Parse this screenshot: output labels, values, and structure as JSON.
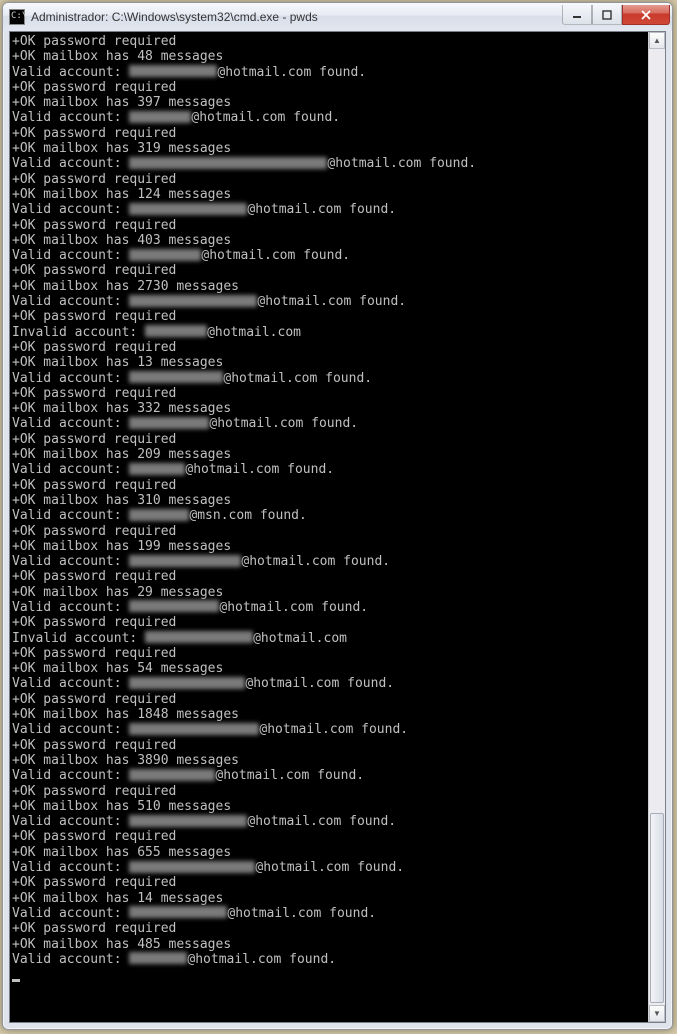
{
  "window": {
    "title": "Administrador: C:\\Windows\\system32\\cmd.exe - pwds",
    "icon_glyph": "C:\\"
  },
  "console_lines": [
    {
      "t": "plain",
      "text": "+OK password required"
    },
    {
      "t": "plain",
      "text": "+OK mailbox has 48 messages"
    },
    {
      "t": "valid",
      "redacted_w": 88,
      "domain": "@hotmail.com"
    },
    {
      "t": "plain",
      "text": "+OK password required"
    },
    {
      "t": "plain",
      "text": "+OK mailbox has 397 messages"
    },
    {
      "t": "valid",
      "redacted_w": 62,
      "domain": "@hotmail.com"
    },
    {
      "t": "plain",
      "text": "+OK password required"
    },
    {
      "t": "plain",
      "text": "+OK mailbox has 319 messages"
    },
    {
      "t": "valid",
      "redacted_w": 198,
      "domain": "@hotmail.com"
    },
    {
      "t": "plain",
      "text": "+OK password required"
    },
    {
      "t": "plain",
      "text": "+OK mailbox has 124 messages"
    },
    {
      "t": "valid",
      "redacted_w": 118,
      "domain": "@hotmail.com"
    },
    {
      "t": "plain",
      "text": "+OK password required"
    },
    {
      "t": "plain",
      "text": "+OK mailbox has 403 messages"
    },
    {
      "t": "valid",
      "redacted_w": 72,
      "domain": "@hotmail.com"
    },
    {
      "t": "plain",
      "text": "+OK password required"
    },
    {
      "t": "plain",
      "text": "+OK mailbox has 2730 messages"
    },
    {
      "t": "valid",
      "redacted_w": 128,
      "domain": "@hotmail.com"
    },
    {
      "t": "plain",
      "text": "+OK password required"
    },
    {
      "t": "invalid",
      "redacted_w": 62,
      "domain": "@hotmail.com"
    },
    {
      "t": "plain",
      "text": "+OK password required"
    },
    {
      "t": "plain",
      "text": "+OK mailbox has 13 messages"
    },
    {
      "t": "valid",
      "redacted_w": 94,
      "domain": "@hotmail.com"
    },
    {
      "t": "plain",
      "text": "+OK password required"
    },
    {
      "t": "plain",
      "text": "+OK mailbox has 332 messages"
    },
    {
      "t": "valid",
      "redacted_w": 80,
      "domain": "@hotmail.com"
    },
    {
      "t": "plain",
      "text": "+OK password required"
    },
    {
      "t": "plain",
      "text": "+OK mailbox has 209 messages"
    },
    {
      "t": "valid",
      "redacted_w": 56,
      "domain": "@hotmail.com"
    },
    {
      "t": "plain",
      "text": "+OK password required"
    },
    {
      "t": "plain",
      "text": "+OK mailbox has 310 messages"
    },
    {
      "t": "valid",
      "redacted_w": 60,
      "domain": "@msn.com"
    },
    {
      "t": "plain",
      "text": "+OK password required"
    },
    {
      "t": "plain",
      "text": "+OK mailbox has 199 messages"
    },
    {
      "t": "valid",
      "redacted_w": 112,
      "domain": "@hotmail.com"
    },
    {
      "t": "plain",
      "text": "+OK password required"
    },
    {
      "t": "plain",
      "text": "+OK mailbox has 29 messages"
    },
    {
      "t": "valid",
      "redacted_w": 90,
      "domain": "@hotmail.com"
    },
    {
      "t": "plain",
      "text": "+OK password required"
    },
    {
      "t": "invalid",
      "redacted_w": 108,
      "domain": "@hotmail.com"
    },
    {
      "t": "plain",
      "text": "+OK password required"
    },
    {
      "t": "plain",
      "text": "+OK mailbox has 54 messages"
    },
    {
      "t": "valid",
      "redacted_w": 116,
      "domain": "@hotmail.com"
    },
    {
      "t": "plain",
      "text": "+OK password required"
    },
    {
      "t": "plain",
      "text": "+OK mailbox has 1848 messages"
    },
    {
      "t": "valid",
      "redacted_w": 130,
      "domain": "@hotmail.com"
    },
    {
      "t": "plain",
      "text": "+OK password required"
    },
    {
      "t": "plain",
      "text": "+OK mailbox has 3890 messages"
    },
    {
      "t": "valid",
      "redacted_w": 86,
      "domain": "@hotmail.com"
    },
    {
      "t": "plain",
      "text": "+OK password required"
    },
    {
      "t": "plain",
      "text": "+OK mailbox has 510 messages"
    },
    {
      "t": "valid",
      "redacted_w": 118,
      "domain": "@hotmail.com"
    },
    {
      "t": "plain",
      "text": "+OK password required"
    },
    {
      "t": "plain",
      "text": "+OK mailbox has 655 messages"
    },
    {
      "t": "valid",
      "redacted_w": 126,
      "domain": "@hotmail.com"
    },
    {
      "t": "plain",
      "text": "+OK password required"
    },
    {
      "t": "plain",
      "text": "+OK mailbox has 14 messages"
    },
    {
      "t": "valid",
      "redacted_w": 98,
      "domain": "@hotmail.com"
    },
    {
      "t": "plain",
      "text": "+OK password required"
    },
    {
      "t": "plain",
      "text": "+OK mailbox has 485 messages"
    },
    {
      "t": "valid",
      "redacted_w": 58,
      "domain": "@hotmail.com"
    }
  ],
  "labels": {
    "valid_prefix": "Valid account: ",
    "invalid_prefix": "Invalid account: ",
    "found_suffix": " found."
  }
}
